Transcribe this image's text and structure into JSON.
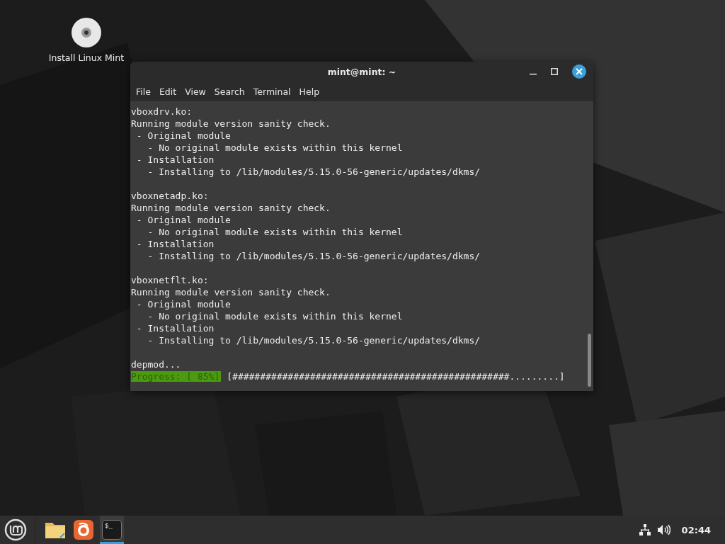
{
  "desktop_icons": [
    {
      "label": "Install Linux Mint"
    }
  ],
  "window": {
    "title": "mint@mint: ~",
    "menu": [
      "File",
      "Edit",
      "View",
      "Search",
      "Terminal",
      "Help"
    ],
    "output_blocks": [
      [
        "vboxdrv.ko:",
        "Running module version sanity check.",
        " - Original module",
        "   - No original module exists within this kernel",
        " - Installation",
        "   - Installing to /lib/modules/5.15.0-56-generic/updates/dkms/"
      ],
      [
        "vboxnetadp.ko:",
        "Running module version sanity check.",
        " - Original module",
        "   - No original module exists within this kernel",
        " - Installation",
        "   - Installing to /lib/modules/5.15.0-56-generic/updates/dkms/"
      ],
      [
        "vboxnetflt.ko:",
        "Running module version sanity check.",
        " - Original module",
        "   - No original module exists within this kernel",
        " - Installation",
        "   - Installing to /lib/modules/5.15.0-56-generic/updates/dkms/"
      ],
      [
        "depmod..."
      ]
    ],
    "progress": {
      "label": "Progress: [ 85%]",
      "bar": "[##################################################.........]"
    }
  },
  "taskbar": {
    "apps": [
      {
        "kind": "files",
        "active": false
      },
      {
        "kind": "browser",
        "active": false
      },
      {
        "kind": "terminal",
        "active": true,
        "glyph": "$_"
      }
    ],
    "clock": "02:44"
  }
}
